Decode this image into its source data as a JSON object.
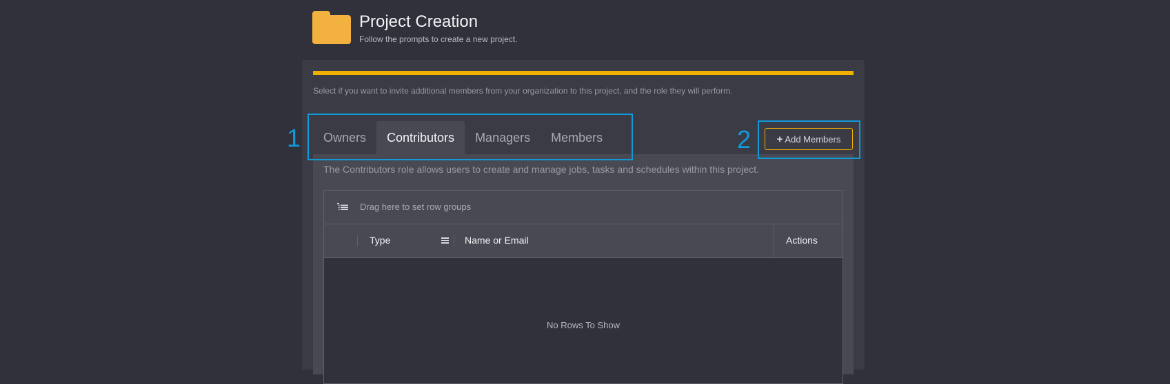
{
  "header": {
    "icon": "folder-icon",
    "title": "Project Creation",
    "subtitle": "Follow the prompts to create a new project."
  },
  "progress": {
    "value": 1.0,
    "color": "#f0b000"
  },
  "instruction": "Select if you want to invite additional members from your organization to this project, and the role they will perform.",
  "tabs": [
    {
      "label": "Owners",
      "active": false
    },
    {
      "label": "Contributors",
      "active": true
    },
    {
      "label": "Managers",
      "active": false
    },
    {
      "label": "Members",
      "active": false
    }
  ],
  "role_description": "The Contributors role allows users to create and manage jobs, tasks and schedules within this project.",
  "grid": {
    "group_placeholder": "Drag here to set row groups",
    "columns": [
      "Type",
      "Name or Email",
      "Actions"
    ],
    "empty_message": "No Rows To Show"
  },
  "add_members": {
    "label": "Add Members",
    "icon": "plus-icon"
  },
  "callouts": [
    "1",
    "2"
  ],
  "colors": {
    "background": "#31313b",
    "panel": "#3b3b46",
    "accent": "#f0b000",
    "folder": "#f3b23f",
    "callout": "#0f9ad8"
  }
}
